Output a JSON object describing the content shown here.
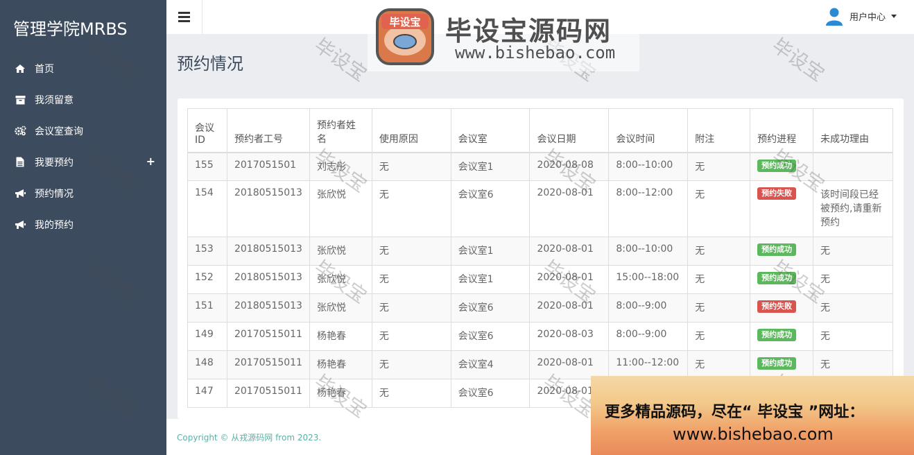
{
  "brand": "管理学院MRBS",
  "sidebar": {
    "items": [
      {
        "label": "首页",
        "icon": "home-icon"
      },
      {
        "label": "我须留意",
        "icon": "archive-icon"
      },
      {
        "label": "会议室查询",
        "icon": "gears-icon"
      },
      {
        "label": "我要预约",
        "icon": "file-icon",
        "expand": "+"
      },
      {
        "label": "预约情况",
        "icon": "bullhorn-icon"
      },
      {
        "label": "我的预约",
        "icon": "bullhorn-icon"
      }
    ]
  },
  "topbar": {
    "user_menu_label": "用户中心"
  },
  "page_title": "预约情况",
  "table": {
    "headers": [
      "会议ID",
      "预约者工号",
      "预约者姓名",
      "使用原因",
      "会议室",
      "会议日期",
      "会议时间",
      "附注",
      "预约进程",
      "未成功理由"
    ],
    "rows": [
      {
        "id": "155",
        "emp": "2017051501",
        "name": "刘志彤",
        "reason": "无",
        "room": "会议室1",
        "date": "2020-08-08",
        "time": "8:00--10:00",
        "note": "无",
        "status": "预约成功",
        "status_type": "success",
        "fail": ""
      },
      {
        "id": "154",
        "emp": "20180515013",
        "name": "张欣悦",
        "reason": "无",
        "room": "会议室6",
        "date": "2020-08-01",
        "time": "8:00--12:00",
        "note": "无",
        "status": "预约失败",
        "status_type": "fail",
        "fail": "该时间段已经被预约,请重新预约"
      },
      {
        "id": "153",
        "emp": "20180515013",
        "name": "张欣悦",
        "reason": "无",
        "room": "会议室1",
        "date": "2020-08-01",
        "time": "8:00--10:00",
        "note": "无",
        "status": "预约成功",
        "status_type": "success",
        "fail": "无"
      },
      {
        "id": "152",
        "emp": "20180515013",
        "name": "张欣悦",
        "reason": "无",
        "room": "会议室1",
        "date": "2020-08-01",
        "time": "15:00--18:00",
        "note": "无",
        "status": "预约成功",
        "status_type": "success",
        "fail": "无"
      },
      {
        "id": "151",
        "emp": "20180515013",
        "name": "张欣悦",
        "reason": "无",
        "room": "会议室6",
        "date": "2020-08-01",
        "time": "8:00--9:00",
        "note": "无",
        "status": "预约失败",
        "status_type": "fail",
        "fail": "无"
      },
      {
        "id": "149",
        "emp": "20170515011",
        "name": "杨艳春",
        "reason": "无",
        "room": "会议室6",
        "date": "2020-08-03",
        "time": "8:00--9:00",
        "note": "无",
        "status": "预约成功",
        "status_type": "success",
        "fail": "无"
      },
      {
        "id": "148",
        "emp": "20170515011",
        "name": "杨艳春",
        "reason": "无",
        "room": "会议室4",
        "date": "2020-08-01",
        "time": "11:00--12:00",
        "note": "无",
        "status": "预约成功",
        "status_type": "success",
        "fail": "无"
      },
      {
        "id": "147",
        "emp": "20170515011",
        "name": "杨艳春",
        "reason": "无",
        "room": "会议室6",
        "date": "2020-08-01",
        "time": "",
        "note": "",
        "status": "",
        "status_type": "",
        "fail": ""
      }
    ]
  },
  "footer": "Copyright © 从戎源码网 from 2023.",
  "watermark": "毕设宝",
  "logo": {
    "badge": "毕设宝",
    "title": "毕设宝源码网",
    "url": "www.bishebao.com"
  },
  "ad": {
    "line1": "更多精品源码，尽在“ 毕设宝 ”网址：",
    "line2": "www.bishebao.com"
  },
  "colors": {
    "sidebar": "#3d4b5e",
    "success": "#5cb85c",
    "fail": "#d9534f",
    "footer_text": "#5bb1a6"
  }
}
